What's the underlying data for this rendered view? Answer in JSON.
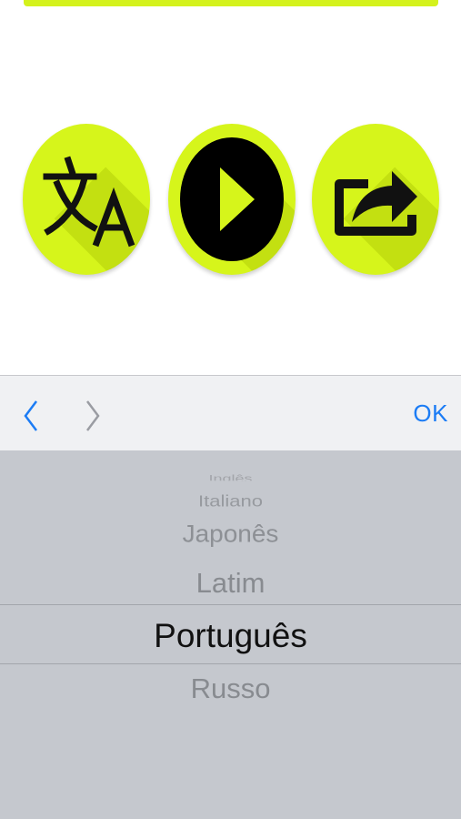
{
  "colors": {
    "accent": "#d6f51b",
    "ok_blue": "#1b7cf5",
    "picker_bg": "#c5c8ce",
    "toolbar_bg": "#f0f1f3"
  },
  "buttons": [
    {
      "icon": "translate-icon"
    },
    {
      "icon": "play-icon"
    },
    {
      "icon": "share-icon"
    }
  ],
  "toolbar": {
    "prev_icon": "chevron-left-icon",
    "next_icon": "chevron-right-icon",
    "ok_label": "OK"
  },
  "picker": {
    "items": [
      "Inglês",
      "Italiano",
      "Japonês",
      "Latim",
      "Português",
      "Russo"
    ],
    "selected": "Português"
  }
}
